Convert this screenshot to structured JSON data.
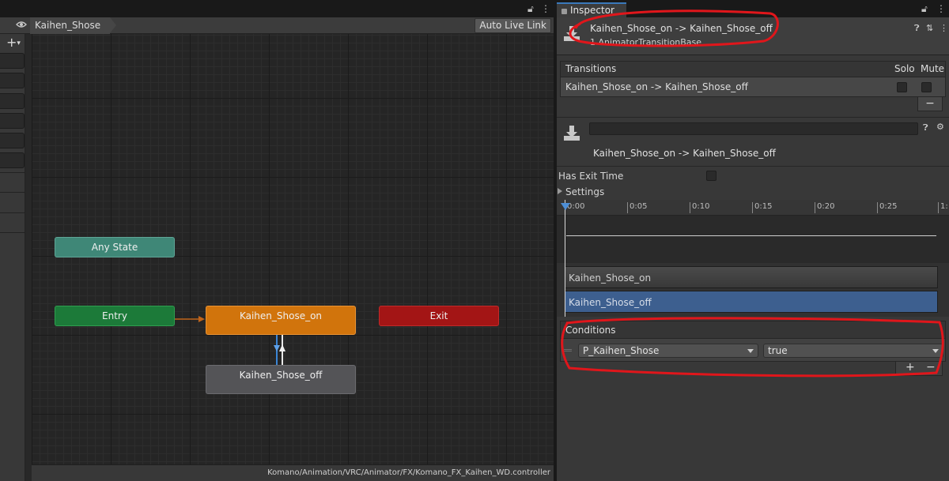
{
  "animator": {
    "breadcrumb": "Kaihen_Shose",
    "live_link_label": "Auto Live Link",
    "status_path": "Komano/Animation/VRC/Animator/FX/Komano_FX_Kaihen_WD.controller",
    "add_label": "+",
    "nodes": {
      "any_state": "Any State",
      "entry": "Entry",
      "exit": "Exit",
      "state_on": "Kaihen_Shose_on",
      "state_off": "Kaihen_Shose_off"
    },
    "node_colors": {
      "any_state": "#3f8777",
      "entry": "#1c7a39",
      "exit": "#a31515",
      "state_on": "#d1740c",
      "state_off": "#545457"
    }
  },
  "inspector": {
    "tab_label": "Inspector",
    "header": {
      "title": "Kaihen_Shose_on -> Kaihen_Shose_off",
      "subtitle": "1 AnimatorTransitionBase"
    },
    "transitions": {
      "header": "Transitions",
      "col_solo": "Solo",
      "col_mute": "Mute",
      "rows": [
        {
          "label": "Kaihen_Shose_on -> Kaihen_Shose_off"
        }
      ],
      "remove_label": "−"
    },
    "transition_detail": {
      "name_value": "",
      "title": "Kaihen_Shose_on -> Kaihen_Shose_off",
      "has_exit_time_label": "Has Exit Time",
      "has_exit_time": false,
      "settings_label": "Settings"
    },
    "timeline": {
      "ticks": [
        "0:00",
        "0:05",
        "0:10",
        "0:15",
        "0:20",
        "0:25",
        "1:"
      ],
      "clip_from": "Kaihen_Shose_on",
      "clip_to": "Kaihen_Shose_off"
    },
    "conditions": {
      "header": "Conditions",
      "rows": [
        {
          "parameter": "P_Kaihen_Shose",
          "value": "true"
        }
      ],
      "add_label": "+",
      "remove_label": "−"
    }
  },
  "annotation_color": "#e0161b"
}
